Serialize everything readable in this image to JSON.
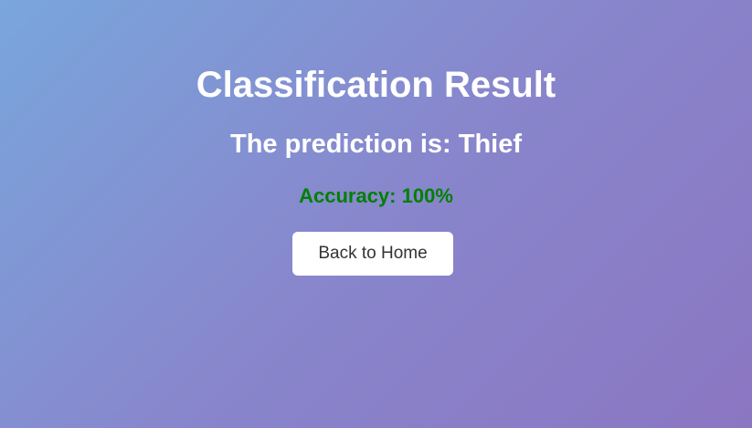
{
  "page": {
    "title": "Classification Result",
    "prediction_text": "The prediction is: Thief",
    "accuracy_label": "Accuracy:",
    "accuracy_value": "100%",
    "home_button_label": "Back to Home"
  },
  "colors": {
    "gradient_start": "#79a6dc",
    "gradient_end": "#8b76c2",
    "accuracy": "#008000",
    "button_bg": "#ffffff",
    "button_text": "#333333"
  }
}
